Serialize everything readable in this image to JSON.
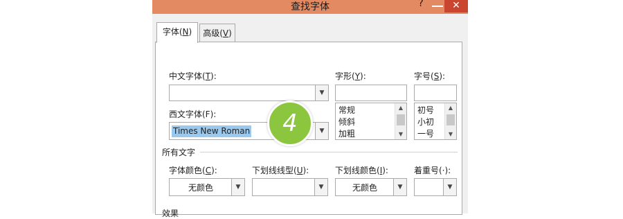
{
  "dialog": {
    "title": "查找字体",
    "help_label": "?",
    "close_label": "✕"
  },
  "tabs": [
    {
      "label_main": "字体(",
      "label_key": "N",
      "label_end": ")"
    },
    {
      "label_main": "高级(",
      "label_key": "V",
      "label_end": ")"
    }
  ],
  "font": {
    "chinese_font_label_main": "中文字体(",
    "chinese_font_label_key": "T",
    "chinese_font_label_end": "):",
    "chinese_font_value": "",
    "western_font_label": "西文字体(F):",
    "western_font_value": "Times New Roman",
    "style_label_main": "字形(",
    "style_label_key": "Y",
    "style_label_end": "):",
    "style_value": "",
    "style_options": [
      "常规",
      "倾斜",
      "加粗"
    ],
    "size_label_main": "字号(",
    "size_label_key": "S",
    "size_label_end": "):",
    "size_value": "",
    "size_options": [
      "初号",
      "小初",
      "一号"
    ]
  },
  "all_text": {
    "section_label": "所有文字",
    "font_color_label_main": "字体颜色(",
    "font_color_label_key": "C",
    "font_color_label_end": "):",
    "font_color_value": "无颜色",
    "underline_type_label_main": "下划线线型(",
    "underline_type_label_key": "U",
    "underline_type_label_end": "):",
    "underline_type_value": "",
    "underline_color_label_main": "下划线颜色(",
    "underline_color_label_key": "I",
    "underline_color_label_end": "):",
    "underline_color_value": "无颜色",
    "emphasis_label": "着重号(·):",
    "emphasis_value": ""
  },
  "effects": {
    "section_label": "效果"
  },
  "step_badge": "4",
  "colors": {
    "titlebar": "#e38a62",
    "close_button": "#c9452f",
    "selection": "#99c9ef",
    "badge": "#8cc63f"
  }
}
